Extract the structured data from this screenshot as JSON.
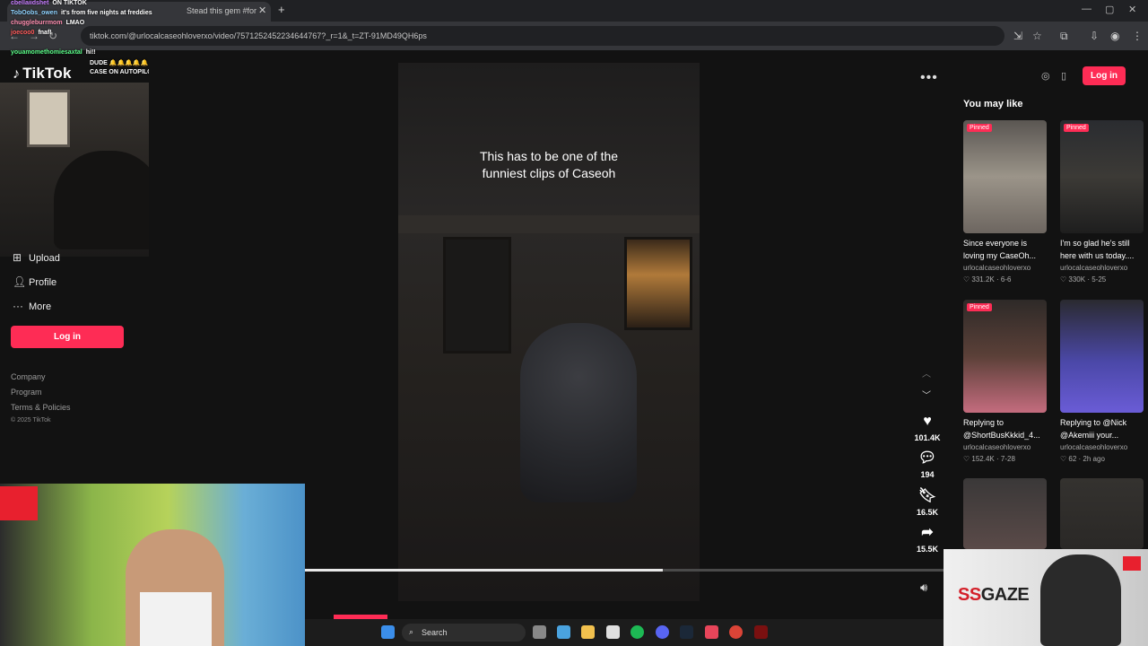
{
  "browser": {
    "tab_title": "Stead this gem #foryoupa",
    "url": "tiktok.com/@urlocalcaseohloverxo/video/7571252452234644767?_r=1&_t=ZT-91MD49QH6ps"
  },
  "chat": [
    {
      "user": "cbellaiidshet",
      "message": "ON TIKTOK",
      "color": "#c77dff"
    },
    {
      "user": "TobOobs_owen",
      "message": "it's from five nights at freddies",
      "color": "#8fd3ff"
    },
    {
      "user": "chuggleburrmom",
      "message": "LMAO",
      "color": "#ff8fb1"
    },
    {
      "user": "joecoo0",
      "message": "fnaf!",
      "color": "#ff5c5c"
    },
    {
      "user": "",
      "message": "",
      "color": "#ff5c5c"
    },
    {
      "user": "youamomethomiesaxtal",
      "message": "hi!!",
      "color": "#5cff8a"
    },
    {
      "user": "",
      "message": "DUDE 🔔🔔🔔🔔🔔",
      "color": "#8fd3ff"
    },
    {
      "user": "",
      "message": "CASE ON AUTOPILOTT",
      "color": "#ffffff"
    }
  ],
  "tiktok": {
    "logo": "TikTok",
    "nav": {
      "upload": "Upload",
      "profile": "Profile",
      "more": "More"
    },
    "login": "Log in",
    "footer": {
      "company": "Company",
      "program": "Program",
      "terms": "Terms & Policies",
      "copyright": "© 2025 TikTok"
    }
  },
  "video": {
    "caption_line1": "This has to be one of the",
    "caption_line2": "funniest clips of Caseoh",
    "likes": "101.4K",
    "comments": "194",
    "saves": "16.5K",
    "shares": "15.5K",
    "progress": 0.56
  },
  "right_panel": {
    "login": "Log in",
    "title": "You may like",
    "cards": [
      {
        "pinned": "Pinned",
        "title": "Since everyone is loving my CaseOh...",
        "user": "urlocalcaseohloverxo",
        "likes": "331.2K",
        "date": "6-6"
      },
      {
        "pinned": "Pinned",
        "title": "I'm so glad he's still here with us today....",
        "user": "urlocalcaseohloverxo",
        "likes": "330K",
        "date": "5-25"
      },
      {
        "pinned": "Pinned",
        "title": "Replying to @ShortBusKkkid_4...",
        "user": "urlocalcaseohloverxo",
        "likes": "152.4K",
        "date": "7-28"
      },
      {
        "pinned": "",
        "title": "Replying to @Nick @Akemiii your...",
        "user": "urlocalcaseohloverxo",
        "likes": "62",
        "date": "2h ago"
      },
      {
        "pinned": "",
        "title": "",
        "user": "",
        "likes": "",
        "date": ""
      },
      {
        "pinned": "",
        "title": "",
        "user": "",
        "likes": "",
        "date": ""
      }
    ]
  },
  "taskbar": {
    "search": "Search"
  },
  "ad": {
    "brand_ss": "SS",
    "brand_rest": "GAZE"
  },
  "colors": {
    "accent": "#fe2c55",
    "background": "#121212"
  },
  "icons": [
    "search-icon",
    "heart-icon",
    "comment-icon",
    "bookmark-icon",
    "share-icon",
    "volume-icon",
    "more-icon",
    "profile-icon",
    "upload-icon"
  ]
}
